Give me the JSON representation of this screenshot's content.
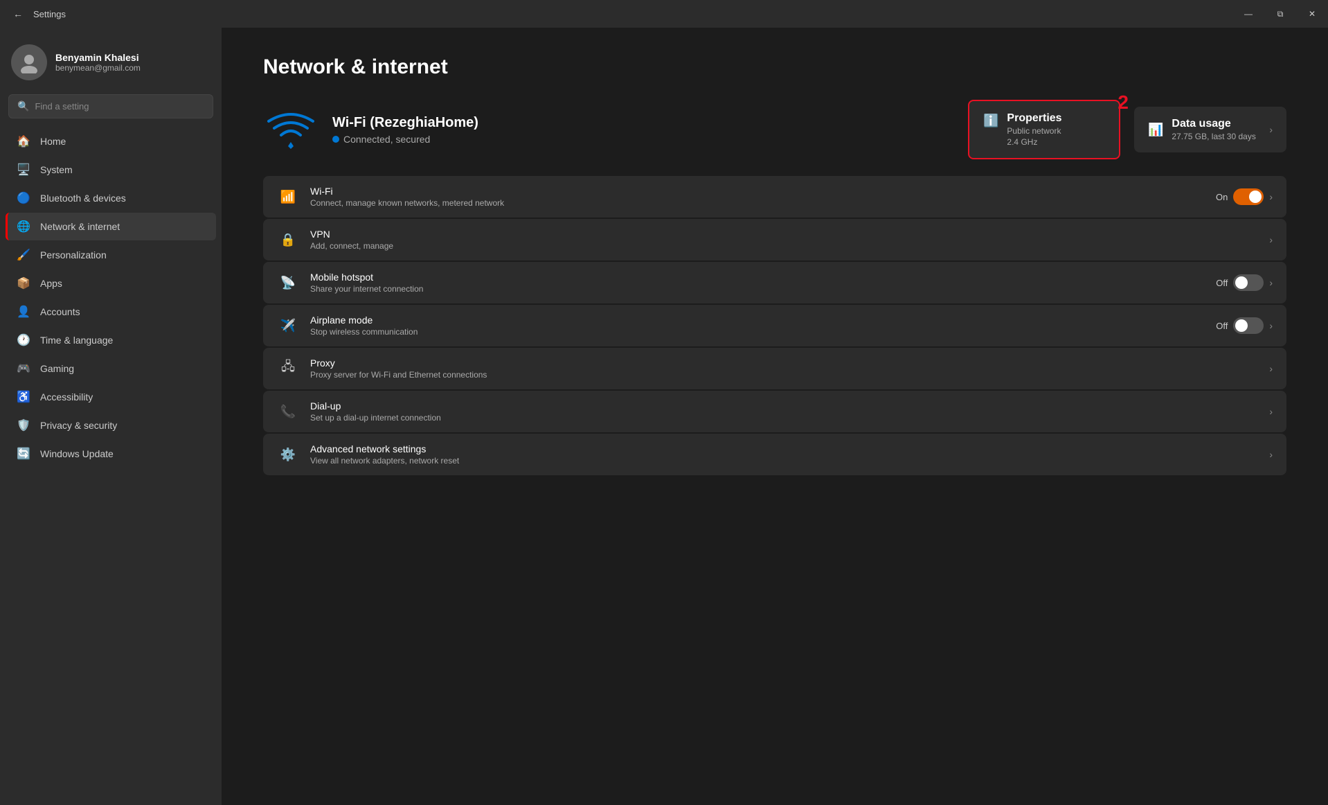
{
  "titlebar": {
    "title": "Settings",
    "back_label": "←",
    "minimize": "—",
    "maximize": "⧉",
    "close": "✕"
  },
  "sidebar": {
    "user": {
      "name": "Benyamin Khalesi",
      "email": "benymean@gmail.com"
    },
    "search_placeholder": "Find a setting",
    "nav_items": [
      {
        "id": "home",
        "label": "Home",
        "icon": "🏠"
      },
      {
        "id": "system",
        "label": "System",
        "icon": "🖥️"
      },
      {
        "id": "bluetooth",
        "label": "Bluetooth & devices",
        "icon": "🔵"
      },
      {
        "id": "network",
        "label": "Network & internet",
        "icon": "🌐",
        "active": true
      },
      {
        "id": "personalization",
        "label": "Personalization",
        "icon": "🖌️"
      },
      {
        "id": "apps",
        "label": "Apps",
        "icon": "📦"
      },
      {
        "id": "accounts",
        "label": "Accounts",
        "icon": "👤"
      },
      {
        "id": "time",
        "label": "Time & language",
        "icon": "🕐"
      },
      {
        "id": "gaming",
        "label": "Gaming",
        "icon": "🎮"
      },
      {
        "id": "accessibility",
        "label": "Accessibility",
        "icon": "♿"
      },
      {
        "id": "privacy",
        "label": "Privacy & security",
        "icon": "🛡️"
      },
      {
        "id": "update",
        "label": "Windows Update",
        "icon": "🔄"
      }
    ]
  },
  "content": {
    "page_title": "Network & internet",
    "wifi_card": {
      "ssid": "Wi-Fi (RezeghiaHome)",
      "status": "Connected, secured",
      "properties_title": "Properties",
      "properties_sub1": "Public network",
      "properties_sub2": "2.4 GHz",
      "data_usage_title": "Data usage",
      "data_usage_sub": "27.75 GB, last 30 days"
    },
    "settings": [
      {
        "id": "wifi",
        "icon": "📶",
        "title": "Wi-Fi",
        "sub": "Connect, manage known networks, metered network",
        "action_type": "toggle",
        "toggle_state": "on",
        "toggle_label": "On",
        "has_chevron": true
      },
      {
        "id": "vpn",
        "icon": "🔒",
        "title": "VPN",
        "sub": "Add, connect, manage",
        "action_type": "chevron",
        "has_chevron": true
      },
      {
        "id": "hotspot",
        "icon": "📡",
        "title": "Mobile hotspot",
        "sub": "Share your internet connection",
        "action_type": "toggle",
        "toggle_state": "off",
        "toggle_label": "Off",
        "has_chevron": true
      },
      {
        "id": "airplane",
        "icon": "✈️",
        "title": "Airplane mode",
        "sub": "Stop wireless communication",
        "action_type": "toggle",
        "toggle_state": "off",
        "toggle_label": "Off",
        "has_chevron": true
      },
      {
        "id": "proxy",
        "icon": "🖧",
        "title": "Proxy",
        "sub": "Proxy server for Wi-Fi and Ethernet connections",
        "action_type": "chevron",
        "has_chevron": true
      },
      {
        "id": "dialup",
        "icon": "📞",
        "title": "Dial-up",
        "sub": "Set up a dial-up internet connection",
        "action_type": "chevron",
        "has_chevron": true
      },
      {
        "id": "advanced",
        "icon": "⚙️",
        "title": "Advanced network settings",
        "sub": "View all network adapters, network reset",
        "action_type": "chevron",
        "has_chevron": true
      }
    ]
  }
}
